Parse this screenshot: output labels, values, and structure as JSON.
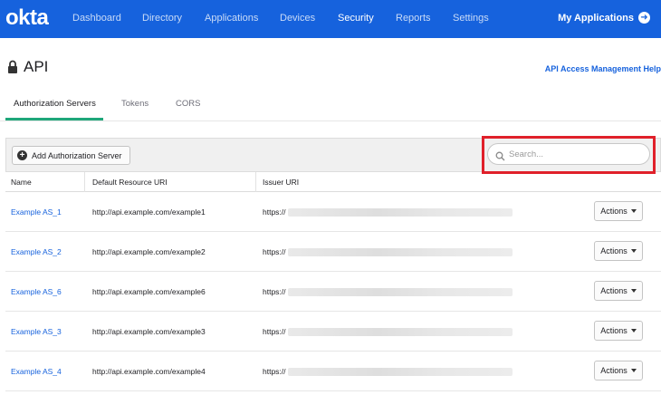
{
  "nav": {
    "logo": "okta",
    "items": [
      {
        "label": "Dashboard",
        "active": false
      },
      {
        "label": "Directory",
        "active": false
      },
      {
        "label": "Applications",
        "active": false
      },
      {
        "label": "Devices",
        "active": false
      },
      {
        "label": "Security",
        "active": true
      },
      {
        "label": "Reports",
        "active": false
      },
      {
        "label": "Settings",
        "active": false
      }
    ],
    "my_apps": "My Applications"
  },
  "page": {
    "title": "API",
    "help_link": "API Access Management Help"
  },
  "tabs": [
    {
      "label": "Authorization Servers",
      "active": true
    },
    {
      "label": "Tokens",
      "active": false
    },
    {
      "label": "CORS",
      "active": false
    }
  ],
  "toolbar": {
    "add_label": "Add Authorization Server",
    "search_placeholder": "Search..."
  },
  "table": {
    "columns": [
      "Name",
      "Default Resource URI",
      "Issuer URI"
    ],
    "rows": [
      {
        "name": "Example AS_1",
        "uri": "http://api.example.com/example1",
        "issuer": "https://",
        "action": "Actions"
      },
      {
        "name": "Example AS_2",
        "uri": "http://api.example.com/example2",
        "issuer": "https://",
        "action": "Actions"
      },
      {
        "name": "Example AS_6",
        "uri": "http://api.example.com/example6",
        "issuer": "https://",
        "action": "Actions"
      },
      {
        "name": "Example AS_3",
        "uri": "http://api.example.com/example3",
        "issuer": "https://",
        "action": "Actions"
      },
      {
        "name": "Example AS_4",
        "uri": "http://api.example.com/example4",
        "issuer": "https://",
        "action": "Actions"
      }
    ]
  },
  "colors": {
    "nav_bg": "#1662dd",
    "link": "#1662dd",
    "tab_accent": "#1fa77a",
    "highlight": "#e0202a"
  }
}
